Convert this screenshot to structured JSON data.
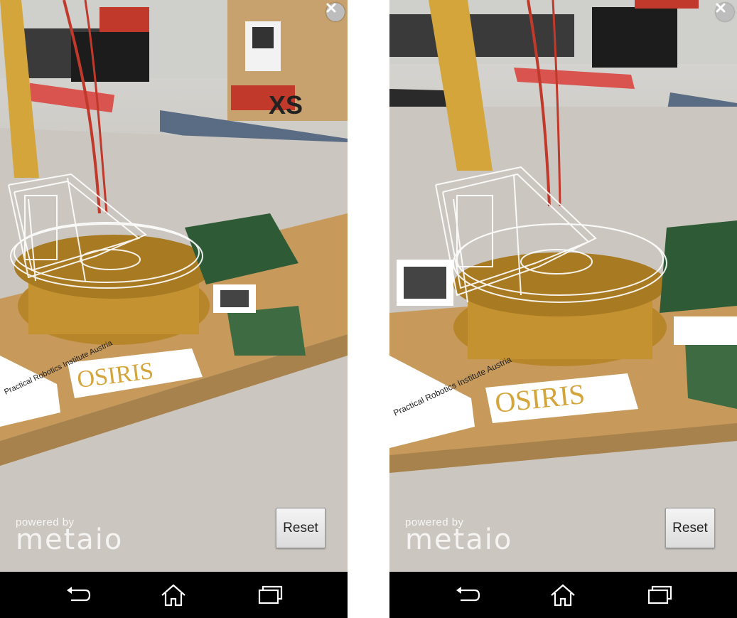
{
  "screens": [
    {
      "id": "left",
      "close_icon": "close-circle-icon",
      "reset_label": "Reset",
      "powered_by_label": "powered by",
      "brand_logo_text": "metaio",
      "sticker_logo_text": "OSIRIS",
      "sticker_text": "Practical Robotics Institute Austria",
      "box_text": "XS",
      "nav": {
        "back_icon": "back-icon",
        "home_icon": "home-icon",
        "recent_icon": "recent-apps-icon"
      }
    },
    {
      "id": "right",
      "close_icon": "close-circle-icon",
      "reset_label": "Reset",
      "powered_by_label": "powered by",
      "brand_logo_text": "metaio",
      "sticker_logo_text": "OSIRIS",
      "sticker_text": "Practical Robotics Institute Austria",
      "nav": {
        "back_icon": "back-icon",
        "home_icon": "home-icon",
        "recent_icon": "recent-apps-icon"
      }
    }
  ],
  "colors": {
    "navbar": "#000000",
    "wood_board": "#c79a5c",
    "robot_base": "#b8862a",
    "overlay": "#ffffff"
  }
}
